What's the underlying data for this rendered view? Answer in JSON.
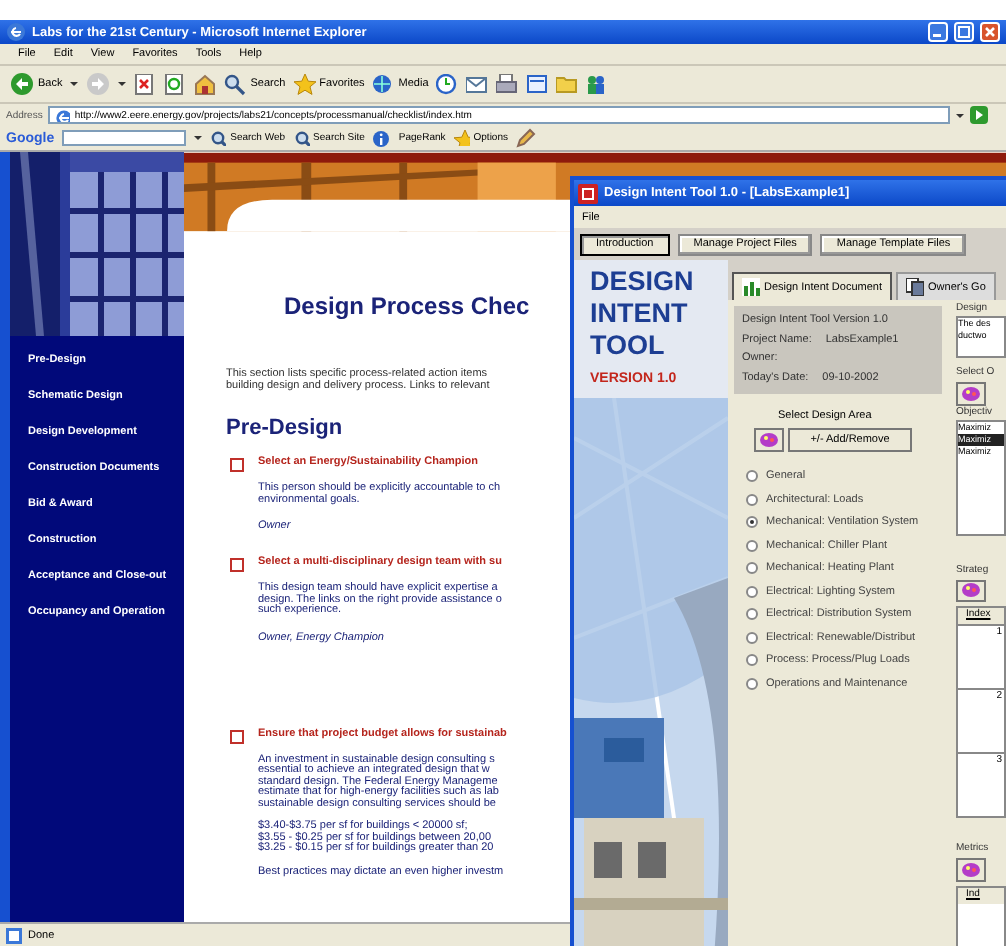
{
  "browser": {
    "title": "Labs for the 21st Century - Microsoft Internet Explorer",
    "menu": [
      "File",
      "Edit",
      "View",
      "Favorites",
      "Tools",
      "Help"
    ],
    "toolbar": [
      "Back",
      "Search",
      "Favorites",
      "Media"
    ],
    "address": {
      "label": "Address",
      "value": "http://www2.eere.energy.gov/projects/labs21/concepts/processmanual/checklist/index.htm"
    },
    "google": {
      "label": "Google",
      "buttons": [
        "Search Web",
        "Search Site",
        "PageRank",
        "Options"
      ]
    },
    "status": "Done"
  },
  "page": {
    "nav": [
      "Pre-Design",
      "Schematic Design",
      "Design Development",
      "Construction Documents",
      "Bid & Award",
      "Construction",
      "Acceptance and Close-out",
      "Occupancy and Operation"
    ],
    "heading": "Design Process Chec",
    "intro": [
      "This section lists specific process-related action items",
      "building design and delivery process. Links to relevant"
    ],
    "section": "Pre-Design",
    "items": [
      {
        "title": "Select an Energy/Sustainability Champion",
        "checked": false,
        "paragraphs": [
          [
            "This person should be explicitly accountable to ch",
            "environmental goals."
          ]
        ],
        "who": "Owner"
      },
      {
        "title": "Select a multi-disciplinary design team with su",
        "checked": false,
        "paragraphs": [
          [
            "This design team should have explicit expertise a",
            "design. The links on the right provide assistance o",
            "such experience."
          ]
        ],
        "who": "Owner, Energy Champion"
      },
      {
        "title": "Ensure that project budget allows for sustainab",
        "checked": false,
        "paragraphs": [
          [
            "An investment in sustainable design consulting s",
            "essential to achieve an integrated design that w",
            "standard design. The Federal Energy Manageme",
            "estimate that for high-energy facilities such as lab",
            "sustainable design consulting services should be"
          ],
          [
            "$3.40-$3.75 per sf for buildings < 20000 sf;",
            "$3.55 - $0.25 per sf for buildings between 20,00",
            "$3.25 - $0.15 per sf for buildings greater than 20"
          ],
          [
            "Best practices may dictate an even higher investm"
          ]
        ]
      }
    ]
  },
  "tool": {
    "title": "Design Intent Tool 1.0 - [LabsExample1]",
    "menu": [
      "File"
    ],
    "buttons": [
      {
        "label": "Introduction",
        "selected": true
      },
      {
        "label": "Manage Project Files",
        "selected": false
      },
      {
        "label": "Manage Template Files",
        "selected": false
      }
    ],
    "logo": {
      "lines": [
        "DESIGN",
        "INTENT",
        "TOOL"
      ],
      "version": "VERSION 1.0"
    },
    "tabs": [
      {
        "label": "Design Intent Document",
        "selected": true
      },
      {
        "label": "Owner's Go",
        "selected": false
      }
    ],
    "info": {
      "heading": "Design Intent Tool Version 1.0",
      "fields": [
        {
          "label": "Project Name:",
          "value": "LabsExample1"
        },
        {
          "label": "Owner:"
        },
        {
          "label": "Today's Date:",
          "value": "09-10-2002"
        }
      ]
    },
    "design_area": {
      "label": "Select Design Area",
      "button": "+/- Add/Remove",
      "options": [
        {
          "label": "General",
          "selected": false
        },
        {
          "label": "Architectural: Loads",
          "selected": false
        },
        {
          "label": "Mechanical: Ventilation System",
          "selected": true
        },
        {
          "label": "Mechanical: Chiller Plant",
          "selected": false
        },
        {
          "label": "Mechanical: Heating Plant",
          "selected": false
        },
        {
          "label": "Electrical: Lighting System",
          "selected": false
        },
        {
          "label": "Electrical: Distribution System",
          "selected": false
        },
        {
          "label": "Electrical: Renewable/Distribut",
          "selected": false
        },
        {
          "label": "Process: Process/Plug Loads",
          "selected": false
        },
        {
          "label": "Operations and Maintenance",
          "selected": false
        }
      ]
    },
    "side": {
      "design_label": "Design",
      "design_text": [
        "The des",
        "ductwo"
      ],
      "select_label": "Select O",
      "objective_label": "Objectiv",
      "objectives": [
        {
          "text": "Maximiz",
          "selected": false
        },
        {
          "text": "Maximiz",
          "selected": true
        },
        {
          "text": "Maximiz",
          "selected": false
        }
      ],
      "strategy_label": "Strateg",
      "index_header": "Index",
      "index_rows": [
        "1",
        "2",
        "3"
      ],
      "metrics_label": "Metrics",
      "metrics_header": "Ind"
    }
  }
}
